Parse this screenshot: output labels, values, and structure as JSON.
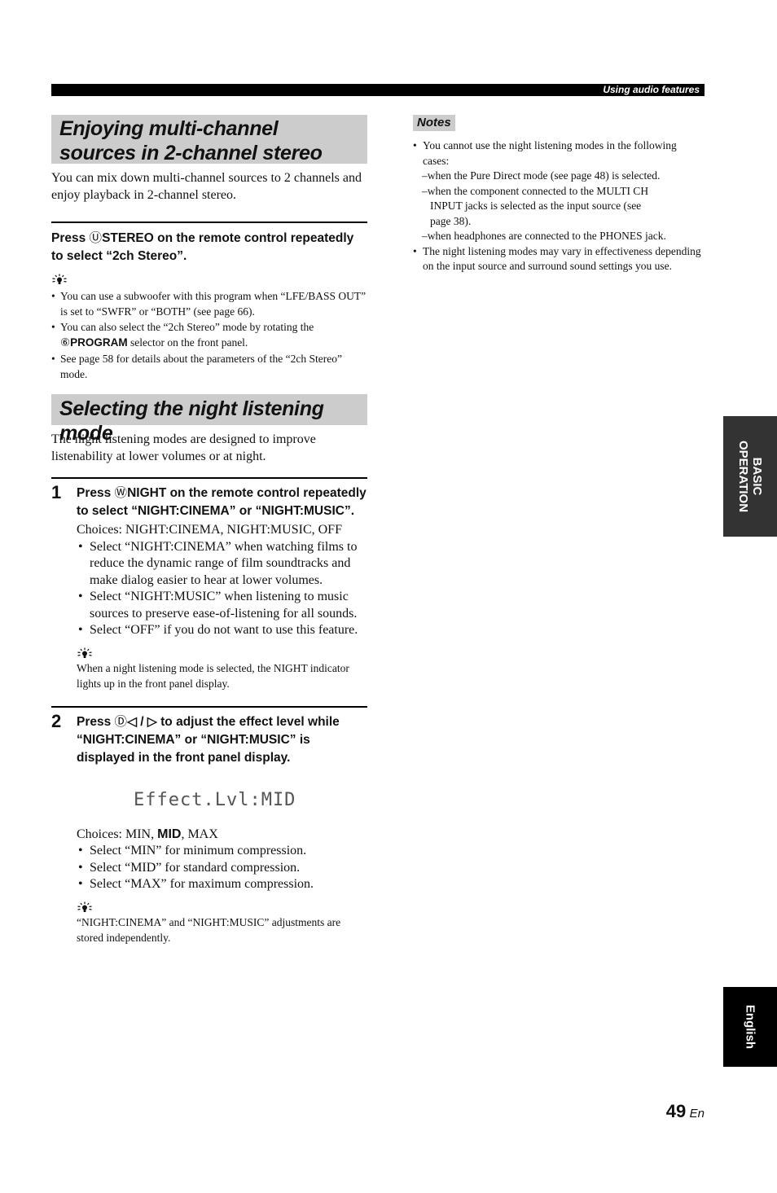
{
  "header": {
    "section_label": "Using audio features"
  },
  "section1": {
    "title": "Enjoying multi-channel sources in 2-channel stereo",
    "intro": "You can mix down multi-channel sources to 2 channels and enjoy playback in 2-channel stereo.",
    "instruction": {
      "prefix": "Press ",
      "key_symbol": "Ⓤ",
      "key_label": "STEREO",
      "suffix": " on the remote control repeatedly to select “2ch Stereo”."
    },
    "tip_icon": "lightbulb-tip-icon",
    "tips": [
      "You can use a subwoofer with this program when “LFE/BASS OUT” is set to “SWFR” or “BOTH” (see page 66).",
      {
        "prefix": "You can also select the “2ch Stereo” mode by rotating the ",
        "key_symbol": "⑥",
        "key_label": "PROGRAM",
        "suffix": " selector on the front panel."
      },
      "See page 58 for details about the parameters of the “2ch Stereo” mode."
    ]
  },
  "section2": {
    "title": "Selecting the night listening mode",
    "intro": "The night listening modes are designed to improve listenability at lower volumes or at night.",
    "steps": [
      {
        "number": "1",
        "instruction": {
          "prefix": "Press ",
          "key_symbol": "Ⓦ",
          "key_label": "NIGHT",
          "suffix": " on the remote control repeatedly to select “NIGHT:CINEMA” or “NIGHT:MUSIC”."
        },
        "choices": "Choices: NIGHT:CINEMA, NIGHT:MUSIC, OFF",
        "bullets": [
          "Select “NIGHT:CINEMA” when watching films to reduce the dynamic range of film soundtracks and make dialog easier to hear at lower volumes.",
          "Select “NIGHT:MUSIC” when listening to music sources to preserve ease-of-listening for all sounds.",
          "Select “OFF” if you do not want to use this feature."
        ],
        "tip": "When a night listening mode is selected, the NIGHT indicator lights up in the front panel display."
      },
      {
        "number": "2",
        "instruction": {
          "prefix": "Press ",
          "key_symbol": "Ⓓ",
          "key_label": "◁ / ▷",
          "suffix": " to adjust the effect level while “NIGHT:CINEMA” or “NIGHT:MUSIC” is displayed in the front panel display."
        },
        "display_text": "Effect.Lvl:MID",
        "choices_prefix": "Choices: MIN, ",
        "choices_default": "MID",
        "choices_suffix": ", MAX",
        "bullets": [
          "Select “MIN” for minimum compression.",
          "Select “MID” for standard compression.",
          "Select “MAX” for maximum compression."
        ],
        "tip": "“NIGHT:CINEMA” and “NIGHT:MUSIC” adjustments are stored independently."
      }
    ]
  },
  "notes": {
    "label": "Notes",
    "items": [
      {
        "text": "You cannot use the night listening modes in the following cases:",
        "sub": [
          [
            "–when the Pure Direct mode (see page 48) is selected."
          ],
          [
            "–when the component connected to the MULTI CH",
            "INPUT jacks is selected as the input source (see",
            "page 38)."
          ],
          [
            "–when headphones are connected to the PHONES jack."
          ]
        ]
      },
      {
        "text": "The night listening modes may vary in effectiveness depending on the input source and surround sound settings you use."
      }
    ]
  },
  "side_tabs": {
    "chapter": [
      "BASIC",
      "OPERATION"
    ],
    "language": "English"
  },
  "footer": {
    "page_number": "49",
    "lang_code": "En"
  }
}
